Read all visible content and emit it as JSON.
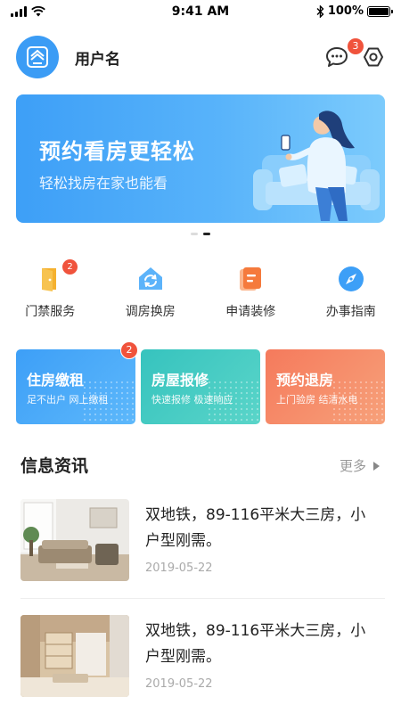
{
  "status_bar": {
    "time": "9:41 AM",
    "battery": "100%"
  },
  "header": {
    "username": "用户名",
    "message_badge": "3"
  },
  "banner": {
    "title": "预约看房更轻松",
    "subtitle": "轻松找房在家也能看"
  },
  "services": [
    {
      "label": "门禁服务",
      "icon": "door-icon",
      "badge": "2",
      "color": "#f5b12f"
    },
    {
      "label": "调房换房",
      "icon": "house-swap-icon",
      "color": "#3d9ff7"
    },
    {
      "label": "申请装修",
      "icon": "renovation-icon",
      "color": "#f57a3c"
    },
    {
      "label": "办事指南",
      "icon": "compass-icon",
      "color": "#3d9ff7"
    }
  ],
  "cards": [
    {
      "title": "住房缴租",
      "subtitle": "足不出户  网上缴租",
      "badge": "2"
    },
    {
      "title": "房屋报修",
      "subtitle": "快速报修  极速响应"
    },
    {
      "title": "预约退房",
      "subtitle": "上门验房  结清水电"
    }
  ],
  "news": {
    "title": "信息资讯",
    "more": "更多",
    "items": [
      {
        "text": "双地铁，89-116平米大三房，小户型刚需。",
        "date": "2019-05-22"
      },
      {
        "text": "双地铁，89-116平米大三房，小户型刚需。",
        "date": "2019-05-22"
      }
    ]
  },
  "colors": {
    "primary": "#3d9ff7",
    "badge": "#f0533c",
    "teal": "#36c3be",
    "orange": "#f57a5c"
  }
}
